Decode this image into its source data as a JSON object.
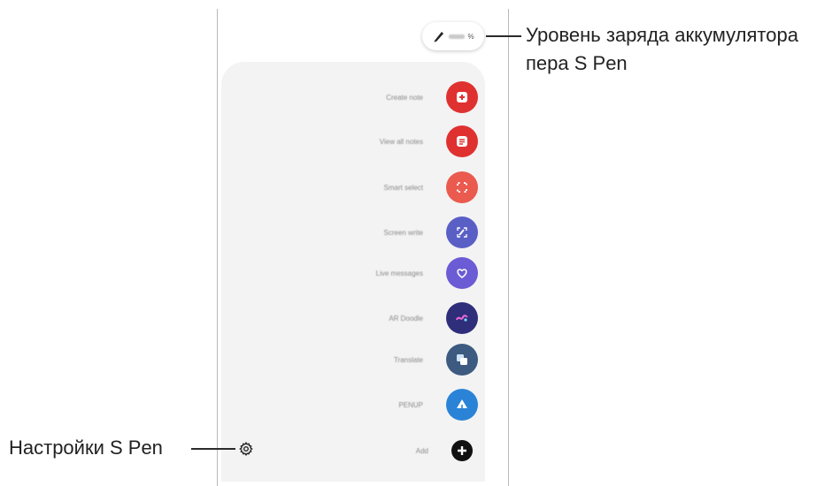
{
  "battery": {
    "percent_symbol": "%"
  },
  "menu": {
    "items": [
      {
        "label": "Create note",
        "icon": "create-note-icon",
        "color": "#e03131"
      },
      {
        "label": "View all notes",
        "icon": "view-notes-icon",
        "color": "#e03131"
      },
      {
        "label": "Smart select",
        "icon": "smart-select-icon",
        "color": "#ea5a4f"
      },
      {
        "label": "Screen write",
        "icon": "screen-write-icon",
        "color": "#5a5fc6"
      },
      {
        "label": "Live messages",
        "icon": "live-messages-icon",
        "color": "#6b5bd4"
      },
      {
        "label": "AR Doodle",
        "icon": "ar-doodle-icon",
        "color": "#2e2e7a"
      },
      {
        "label": "Translate",
        "icon": "translate-icon",
        "color": "#3d5a80"
      },
      {
        "label": "PENUP",
        "icon": "penup-icon",
        "color": "#2a83d6"
      },
      {
        "label": "Add",
        "icon": "add-icon",
        "color": "#111111"
      }
    ]
  },
  "callouts": {
    "battery_line1": "Уровень заряда аккумулятора",
    "battery_line2": "пера S Pen",
    "settings": "Настройки S Pen"
  }
}
